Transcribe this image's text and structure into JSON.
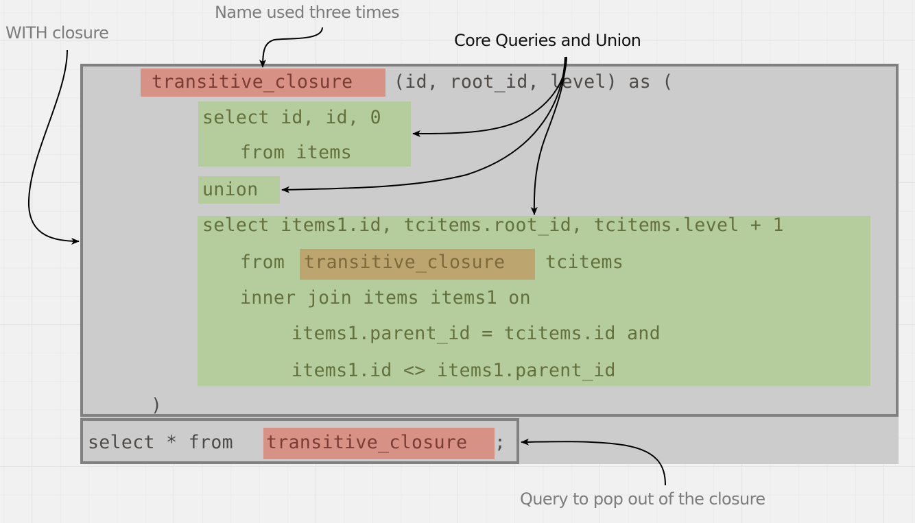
{
  "annotations": {
    "with_closure": "WITH closure",
    "name_used": "Name used three times",
    "core_queries": "Core Queries and Union",
    "pop_out": "Query to pop out of the closure"
  },
  "colors": {
    "name_highlight": "#d79185",
    "core_highlight": "#b5cd9c",
    "recursive_ref_highlight": "#bca56f",
    "box_fill": "#cccccc",
    "box_border": "#808080"
  },
  "code": {
    "cte_name": "transitive_closure",
    "cte_signature": "(id, root_id, level) as (",
    "anchor_line1": "select id, id, 0",
    "anchor_line2": "from items",
    "union": "union",
    "recursive_line1": "select items1.id, tcitems.root_id, tcitems.level + 1",
    "recursive_from": "from",
    "recursive_ref": "transitive_closure",
    "recursive_alias": "tcitems",
    "recursive_join": "inner join items items1 on",
    "recursive_cond1": "items1.parent_id = tcitems.id and",
    "recursive_cond2": "items1.id <> items1.parent_id",
    "close_paren": ")",
    "final_prefix": "select * from",
    "final_name": "transitive_closure",
    "final_suffix": ";"
  }
}
